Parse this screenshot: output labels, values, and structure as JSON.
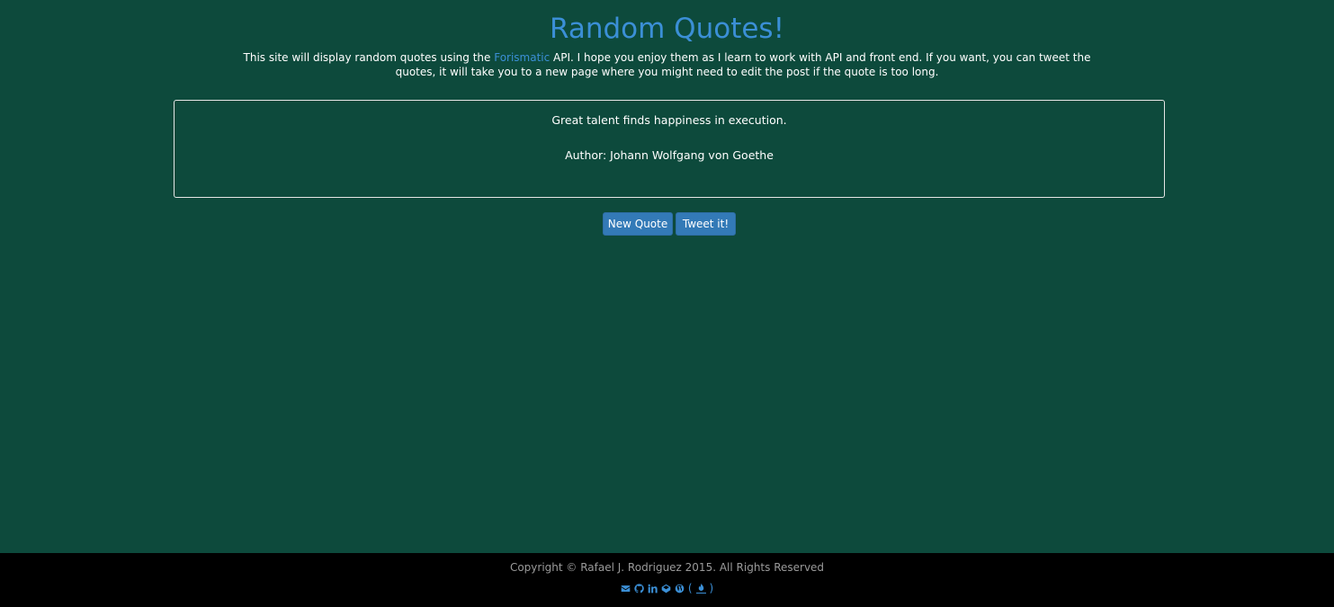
{
  "header": {
    "title": "Random Quotes!",
    "intro_before": "This site will display random quotes using the ",
    "intro_link": "Forismatic",
    "intro_after": " API. I hope you enjoy them as I learn to work with API and front end. If you want, you can tweet the quotes, it will take you to a new page where you might need to edit the post if the quote is too long."
  },
  "quote": {
    "text": "Great talent finds happiness in execution.",
    "author": "Author: Johann Wolfgang von Goethe"
  },
  "buttons": {
    "new_quote": "New Quote",
    "tweet": "Tweet it!"
  },
  "footer": {
    "copyright": "Copyright © Rafael J. Rodriguez 2015. All Rights Reserved",
    "icons": [
      "email-icon",
      "github-icon",
      "linkedin-icon",
      "codepen-icon",
      "wordpress-icon",
      "fire-icon"
    ],
    "paren_open": "(",
    "paren_close": ")"
  },
  "colors": {
    "background": "#0d4a3c",
    "accent": "#3b8fd6",
    "button": "#337ab7",
    "footer_bg": "#000000"
  }
}
